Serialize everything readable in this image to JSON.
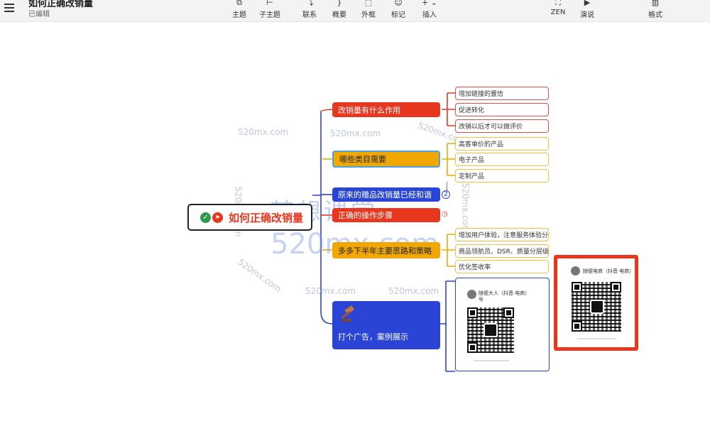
{
  "header": {
    "doc_title": "如何正确改销量",
    "doc_status": "已编辑",
    "tools": [
      {
        "label": "主题",
        "icon": "topic-icon",
        "glyph": "⧉"
      },
      {
        "label": "子主题",
        "icon": "subtopic-icon",
        "glyph": "⊢"
      },
      {
        "label": "联系",
        "icon": "relationship-icon",
        "glyph": "⤵"
      },
      {
        "label": "概要",
        "icon": "summary-icon",
        "glyph": "}"
      },
      {
        "label": "外框",
        "icon": "boundary-icon",
        "glyph": "⬚"
      },
      {
        "label": "标记",
        "icon": "marker-icon",
        "glyph": "☺"
      },
      {
        "label": "插入",
        "icon": "insert-icon",
        "glyph": "+ ⌄"
      },
      {
        "label": "ZEN",
        "icon": "zen-icon",
        "glyph": "⛶"
      },
      {
        "label": "演说",
        "icon": "pitch-icon",
        "glyph": "▶"
      },
      {
        "label": "格式",
        "icon": "format-icon",
        "glyph": "▥"
      }
    ]
  },
  "mindmap": {
    "root": {
      "label": "如何正确改销量",
      "check_glyph": "✓",
      "flag_glyph": "⚑"
    },
    "branches": [
      {
        "label": "改销量有什么作用",
        "children": [
          "增加链接的置信",
          "促进转化",
          "改销以后才可以做评价"
        ]
      },
      {
        "label": "哪些类目需要",
        "children": [
          "高客单价的产品",
          "电子产品",
          "定制产品"
        ]
      },
      {
        "label": "原来的赠品改销量已经和谐",
        "marker": "2"
      },
      {
        "label": "正确的操作步骤",
        "marker": "◷"
      },
      {
        "label": "多多下半年主要思路和策略",
        "children": [
          "增加用户体验，注意服务体验分",
          "商品领航员、DSR、质量分层级",
          "优化签收率"
        ]
      },
      {
        "label": "打个广告，案例展示"
      }
    ],
    "cards": [
      {
        "name": "随便大人（抖音·电商）",
        "line2": "号"
      },
      {
        "name": "随便电商（抖音·电商）"
      }
    ]
  },
  "watermarks": {
    "small": "520mx.com",
    "big_cn": "梦想课堂",
    "big_url": "520mx.com"
  },
  "colors": {
    "red": "#e8371f",
    "orange": "#f0a800",
    "blue": "#2a45d6",
    "card_border": "#e8371f"
  }
}
